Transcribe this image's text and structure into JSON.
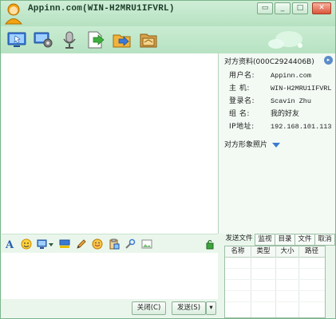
{
  "window": {
    "title": "Appinn.com(WIN-H2MRU1IFVRL)"
  },
  "title_buttons": {
    "restore": "▭",
    "minimize": "_",
    "maximize": "□",
    "close": "✕"
  },
  "toolbar": {
    "icons": [
      "screen-share-icon",
      "remote-assist-icon",
      "microphone-icon",
      "send-file-icon",
      "folder-icon",
      "package-icon"
    ]
  },
  "profile": {
    "header": "对方资料(000C2924406B)",
    "nav": "▸",
    "rows": [
      {
        "label": "用户名:",
        "value": "Appinn.com"
      },
      {
        "label": "主  机:",
        "value": "WIN-H2MRU1IFVRL"
      },
      {
        "label": "登录名:",
        "value": "Scavin Zhu"
      },
      {
        "label": "组  名:",
        "value": "我的好友"
      },
      {
        "label": "IP地址:",
        "value": "192.168.101.113"
      }
    ],
    "photo_label": "对方形象照片"
  },
  "format_toolbar": {
    "icons": [
      "font-icon",
      "emoticon-icon",
      "screenshot-icon",
      "dropdown-arrow-icon",
      "color-bar-icon",
      "pencil-icon",
      "sticker-icon",
      "clipboard-icon",
      "tools-icon",
      "image-icon",
      "lock-icon"
    ]
  },
  "buttons": {
    "close": "关闭(C)",
    "send": "发送(S)",
    "send_dropdown": "▾"
  },
  "file_panel": {
    "label": "发送文件",
    "tabs": [
      "监视",
      "目录",
      "文件",
      "取消"
    ],
    "columns": [
      "名称",
      "类型",
      "大小",
      "路径"
    ]
  },
  "colors": {
    "frame": "#7bb58c",
    "toolbar": "#b7e2c2",
    "accent": "#3d7ad0"
  }
}
